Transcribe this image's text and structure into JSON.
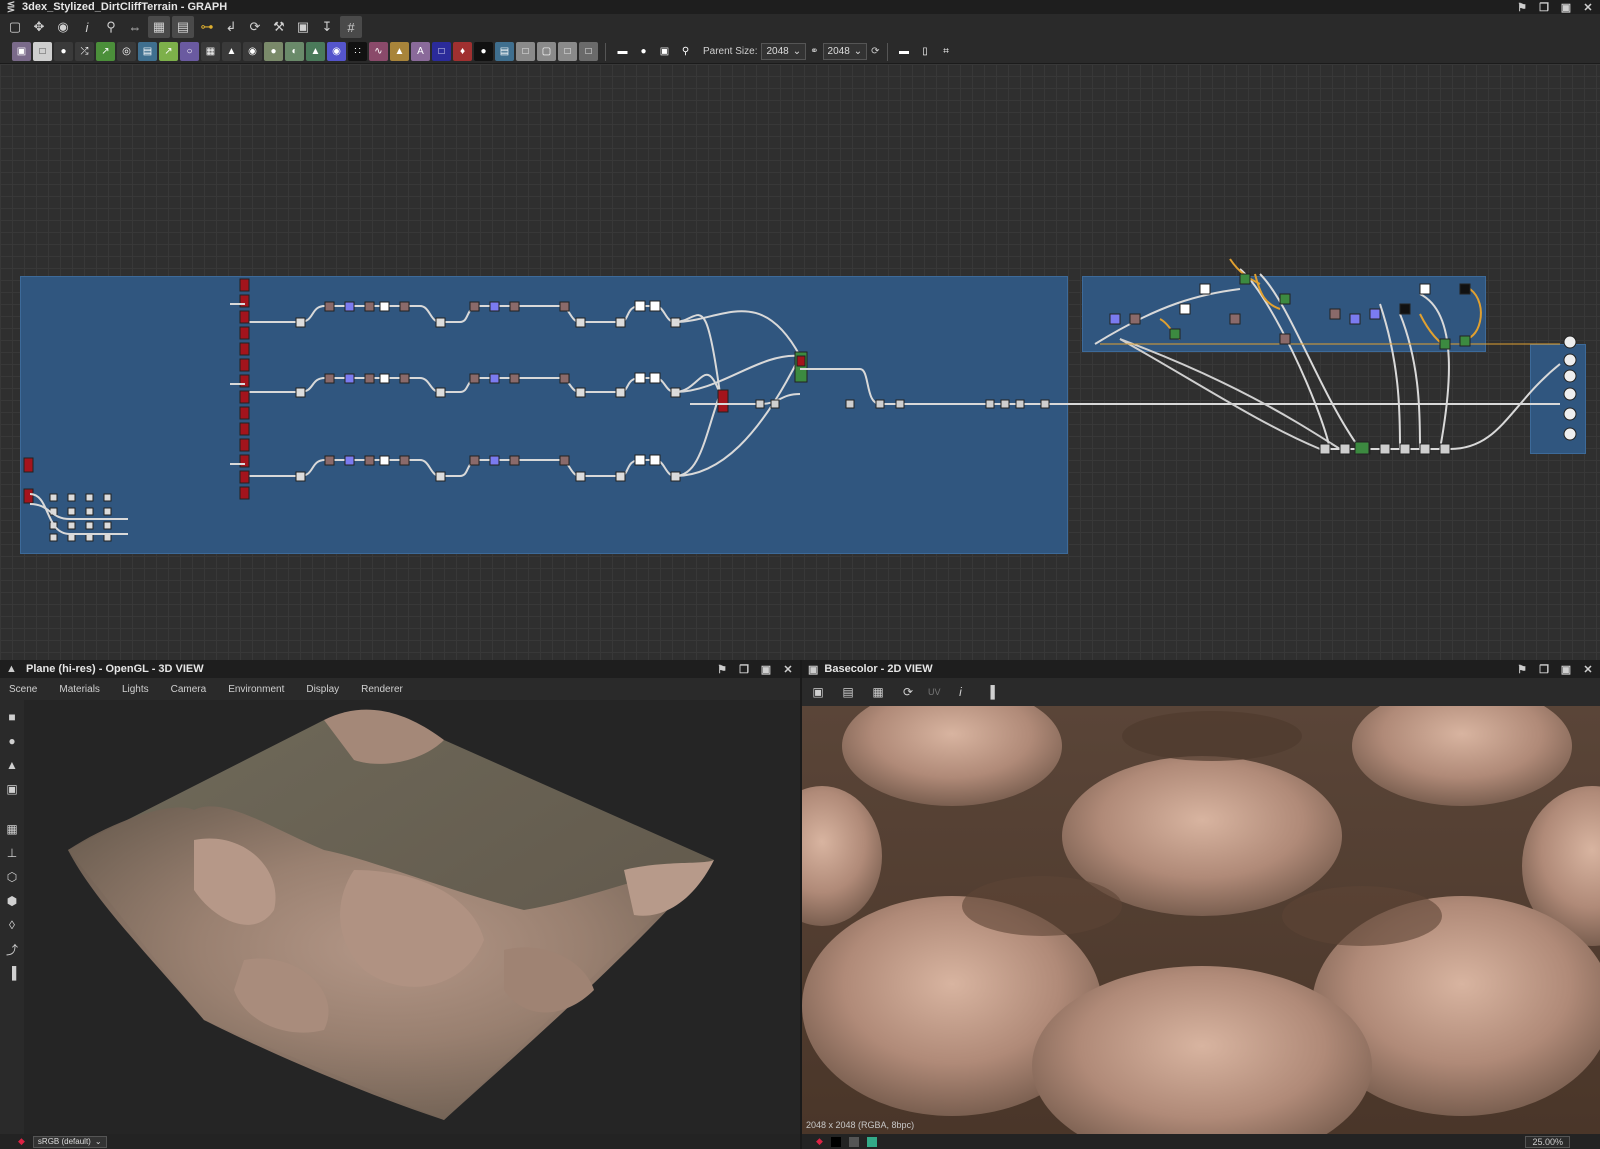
{
  "graph_panel": {
    "title": "3dex_Stylized_DirtCliffTerrain - GRAPH",
    "parent_size_label": "Parent Size:",
    "parent_size_value": "2048",
    "linked_size_value": "2048",
    "toolbar_icons": [
      "frame-icon",
      "move-icon",
      "camera-icon",
      "info-icon",
      "search-icon",
      "link-icon",
      "layout-icon",
      "panel-icon",
      "connect-icon",
      "route-icon",
      "refresh-icon",
      "wrench-icon",
      "export-icon",
      "publish-icon",
      "grid-icon"
    ]
  },
  "view3d": {
    "title": "Plane (hi-res) - OpenGL - 3D VIEW",
    "menu": [
      "Scene",
      "Materials",
      "Lights",
      "Camera",
      "Environment",
      "Display",
      "Renderer"
    ],
    "colorspace": "sRGB (default)"
  },
  "view2d": {
    "title": "Basecolor - 2D VIEW",
    "uv_label": "UV",
    "image_info": "2048 x 2048 (RGBA, 8bpc)",
    "zoom": "25.00%"
  },
  "colors": {
    "frame_blue": "#30567f",
    "node_red": "#a3141c",
    "node_green": "#3c8a40",
    "wire": "#d9d9d9",
    "wire_orange": "#e0a030",
    "node_purple": "#7b7bf0"
  }
}
